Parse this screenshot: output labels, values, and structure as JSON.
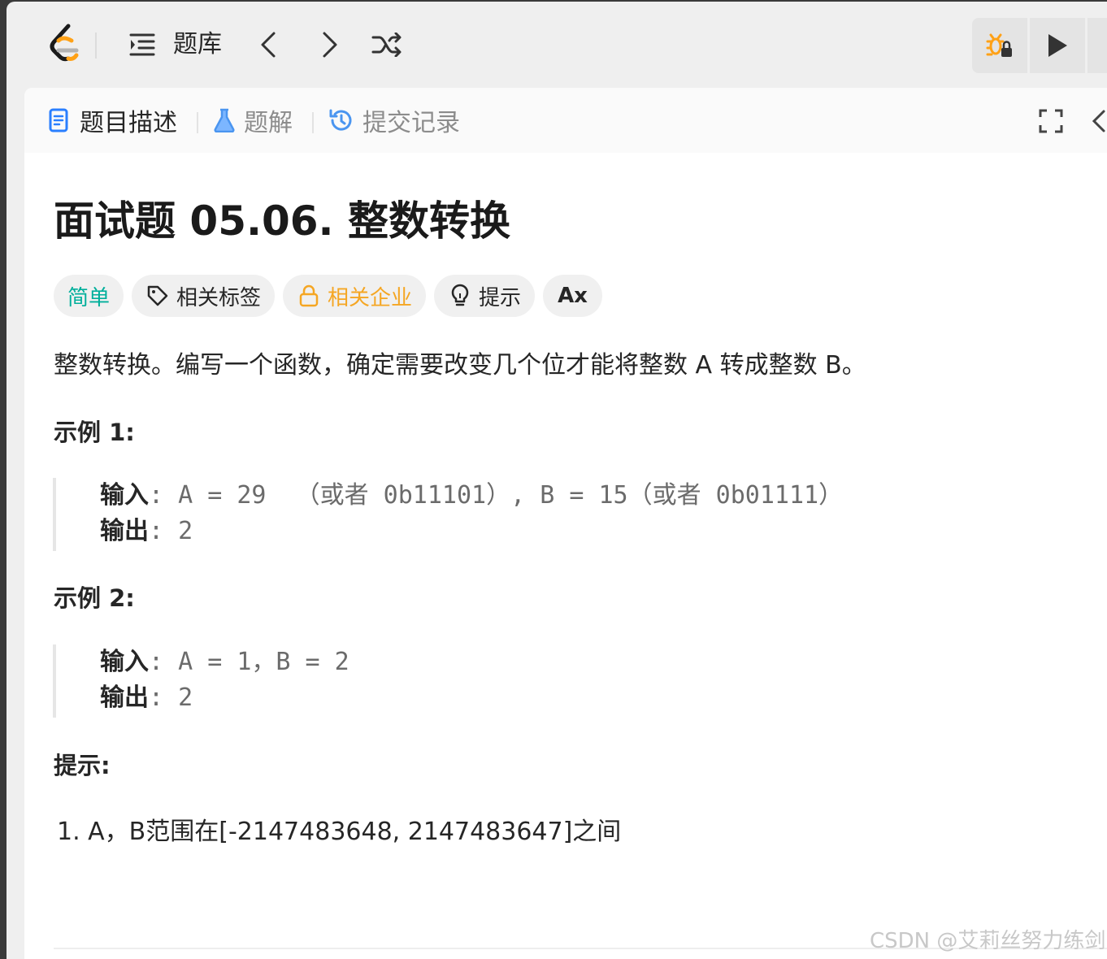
{
  "nav": {
    "problem_list_label": "题库"
  },
  "tabs": [
    {
      "label": "题目描述"
    },
    {
      "label": "题解"
    },
    {
      "label": "提交记录"
    }
  ],
  "problem": {
    "title": "面试题 05.06. 整数转换",
    "tags": {
      "difficulty": "简单",
      "related_tags": "相关标签",
      "related_companies": "相关企业",
      "hint": "提示",
      "translate": "Ax"
    },
    "description": "整数转换。编写一个函数，确定需要改变几个位才能将整数 A 转成整数 B。",
    "examples": [
      {
        "heading": "示例 1:",
        "input_label": "输入",
        "input_value": ": A = 29  （或者 0b11101）, B = 15（或者 0b01111）",
        "output_label": "输出",
        "output_value": ": 2"
      },
      {
        "heading": "示例 2:",
        "input_label": "输入",
        "input_value": ": A = 1，B = 2",
        "output_label": "输出",
        "output_value": ": 2"
      }
    ],
    "hints_heading": "提示:",
    "hints": [
      "1. A，B范围在[-2147483648, 2147483647]之间"
    ]
  },
  "watermark": "CSDN @艾莉丝努力练剑",
  "colors": {
    "easy": "#00af9b",
    "company_lock": "#f5a623",
    "logo_orange": "#ffa116"
  }
}
